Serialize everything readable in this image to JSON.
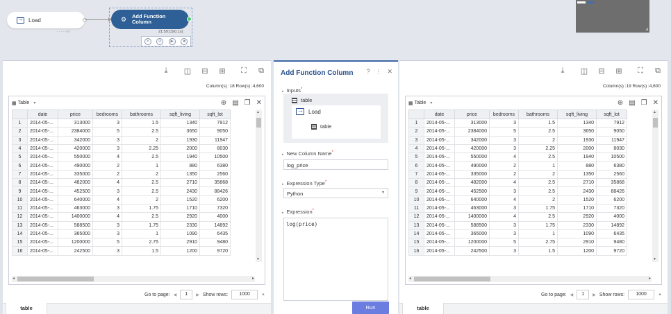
{
  "canvas": {
    "load_node": {
      "label": "Load",
      "sub": "- - - - -(-)"
    },
    "fn_node": {
      "label_line1": "Add Function",
      "label_line2": "Column",
      "time": "21:59:15(0.1s)"
    }
  },
  "tables": {
    "left": {
      "col_row": "Column(s) :18  Row(s) :4,600",
      "table_label": "Table",
      "columns": [
        "",
        "date",
        "price",
        "bedrooms",
        "bathrooms",
        "sqft_living",
        "sqft_lot"
      ],
      "rows": [
        [
          "1",
          "2014-05-...",
          "313000",
          "3",
          "1.5",
          "1340",
          "7912"
        ],
        [
          "2",
          "2014-05-...",
          "2384000",
          "5",
          "2.5",
          "3650",
          "9050"
        ],
        [
          "3",
          "2014-05-...",
          "342000",
          "3",
          "2",
          "1930",
          "11947"
        ],
        [
          "4",
          "2014-05-...",
          "420000",
          "3",
          "2.25",
          "2000",
          "8030"
        ],
        [
          "5",
          "2014-05-...",
          "550000",
          "4",
          "2.5",
          "1940",
          "10500"
        ],
        [
          "6",
          "2014-05-...",
          "490000",
          "2",
          "1",
          "880",
          "6380"
        ],
        [
          "7",
          "2014-05-...",
          "335000",
          "2",
          "2",
          "1350",
          "2560"
        ],
        [
          "8",
          "2014-05-...",
          "482000",
          "4",
          "2.5",
          "2710",
          "35868"
        ],
        [
          "9",
          "2014-05-...",
          "452500",
          "3",
          "2.5",
          "2430",
          "88426"
        ],
        [
          "10",
          "2014-05-...",
          "640000",
          "4",
          "2",
          "1520",
          "6200"
        ],
        [
          "11",
          "2014-05-...",
          "463000",
          "3",
          "1.75",
          "1710",
          "7320"
        ],
        [
          "12",
          "2014-05-...",
          "1400000",
          "4",
          "2.5",
          "2920",
          "4000"
        ],
        [
          "13",
          "2014-05-...",
          "588500",
          "3",
          "1.75",
          "2330",
          "14892"
        ],
        [
          "14",
          "2014-05-...",
          "365000",
          "3",
          "1",
          "1090",
          "6435"
        ],
        [
          "15",
          "2014-05-...",
          "1200000",
          "5",
          "2.75",
          "2910",
          "9480"
        ],
        [
          "16",
          "2014-05-...",
          "242500",
          "3",
          "1.5",
          "1200",
          "9720"
        ]
      ],
      "pager": {
        "go_to": "Go to page:",
        "page": "1",
        "show_rows": "Show rows:",
        "rows": "1000"
      },
      "tab": "table"
    },
    "right": {
      "col_row": "Column(s) :19  Row(s) :4,600",
      "table_label": "Table",
      "pager": {
        "go_to": "Go to page:",
        "page": "1",
        "show_rows": "Show rows:",
        "rows": "1000"
      },
      "tab": "table"
    }
  },
  "panel": {
    "title": "Add Function Column",
    "inputs_label": "Inputs",
    "input_table": "table",
    "input_load": "Load",
    "input_load_table": "table",
    "new_col_label": "New Column Name",
    "new_col_value": "log_price",
    "expr_type_label": "Expression Type",
    "expr_type_value": "Python",
    "expr_label": "Expression",
    "expr_value": "log(price)",
    "run": "Run"
  },
  "colors": {
    "accent": "#2e5f96",
    "run": "#6b7de0",
    "port_ok": "#4cc86a"
  }
}
